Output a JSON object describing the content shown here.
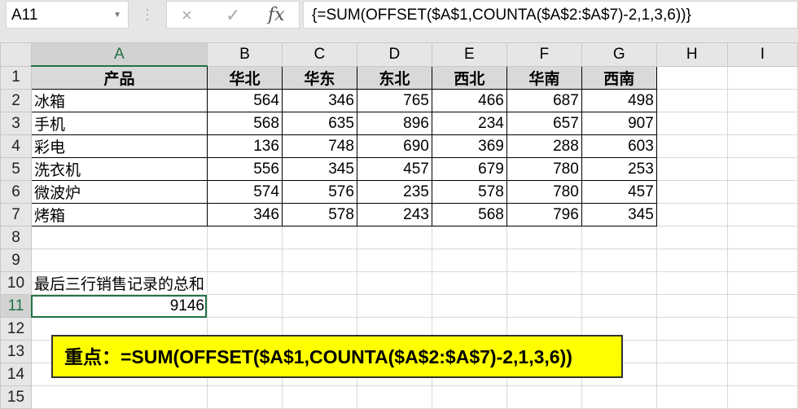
{
  "name_box": "A11",
  "formula_bar": {
    "cancel_icon": "×",
    "enter_icon": "✓",
    "fx_label": "fx",
    "formula": "{=SUM(OFFSET($A$1,COUNTA($A$2:$A$7)-2,1,3,6))}"
  },
  "columns": [
    "A",
    "B",
    "C",
    "D",
    "E",
    "F",
    "G",
    "H",
    "I"
  ],
  "rows": [
    "1",
    "2",
    "3",
    "4",
    "5",
    "6",
    "7",
    "8",
    "9",
    "10",
    "11",
    "12",
    "13",
    "14",
    "15"
  ],
  "table": {
    "headers": [
      "产品",
      "华北",
      "华东",
      "东北",
      "西北",
      "华南",
      "西南"
    ],
    "data": [
      [
        "冰箱",
        "564",
        "346",
        "765",
        "466",
        "687",
        "498"
      ],
      [
        "手机",
        "568",
        "635",
        "896",
        "234",
        "657",
        "907"
      ],
      [
        "彩电",
        "136",
        "748",
        "690",
        "369",
        "288",
        "603"
      ],
      [
        "洗衣机",
        "556",
        "345",
        "457",
        "679",
        "780",
        "253"
      ],
      [
        "微波炉",
        "574",
        "576",
        "235",
        "578",
        "780",
        "457"
      ],
      [
        "烤箱",
        "346",
        "578",
        "243",
        "568",
        "796",
        "345"
      ]
    ]
  },
  "label_a10": "最后三行销售记录的总和",
  "result_a11": "9146",
  "note": "重点：=SUM(OFFSET($A$1,COUNTA($A$2:$A$7)-2,1,3,6))"
}
